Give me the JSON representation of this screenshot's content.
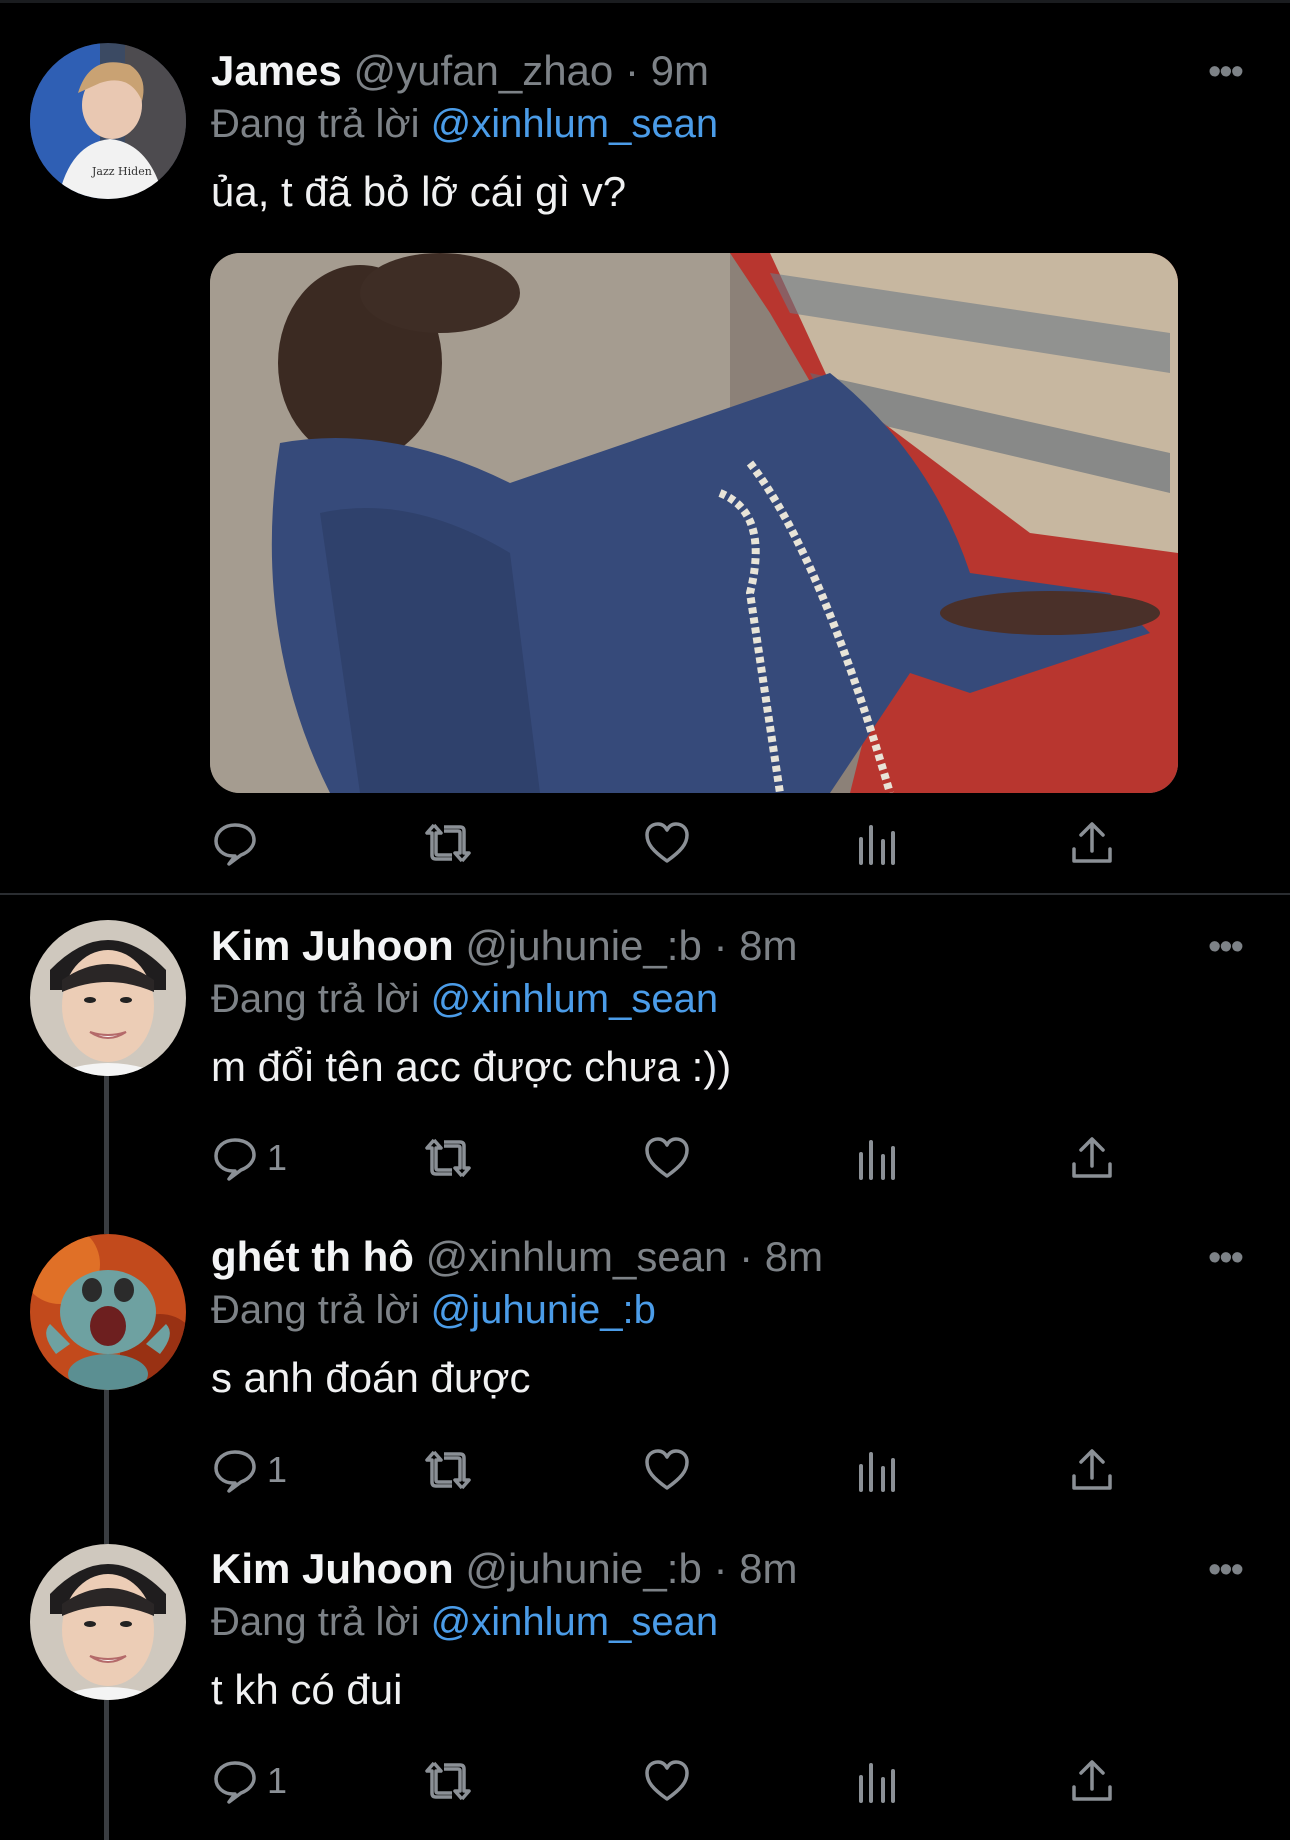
{
  "colors": {
    "background": "#000000",
    "accent": "#4b9ce8",
    "muted": "#7d8287"
  },
  "tweets": [
    {
      "name": "James",
      "handle": "@yufan_zhao",
      "time": "9m",
      "replying_label": "Đang trả lời",
      "replying_to": "@xinhlum_sean",
      "text": "ủa, t đã bỏ lỡ cái gì v?",
      "has_media": true,
      "reply_count": ""
    },
    {
      "name": "Kim Juhoon",
      "handle": "@juhunie_:b",
      "time": "8m",
      "replying_label": "Đang trả lời",
      "replying_to": "@xinhlum_sean",
      "text": "m đổi tên acc được chưa :))",
      "reply_count": "1"
    },
    {
      "name": "ghét th hô",
      "handle": "@xinhlum_sean",
      "time": "8m",
      "replying_label": "Đang trả lời",
      "replying_to": "@juhunie_:b",
      "text": "s anh đoán được",
      "reply_count": "1"
    },
    {
      "name": "Kim Juhoon",
      "handle": "@juhunie_:b",
      "time": "8m",
      "replying_label": "Đang trả lời",
      "replying_to": "@xinhlum_sean",
      "text": "t kh có đui",
      "reply_count": "1"
    }
  ],
  "separator": "·",
  "more_glyph": "•••",
  "icons": [
    "reply-icon",
    "retweet-icon",
    "like-icon",
    "analytics-icon",
    "share-icon"
  ]
}
